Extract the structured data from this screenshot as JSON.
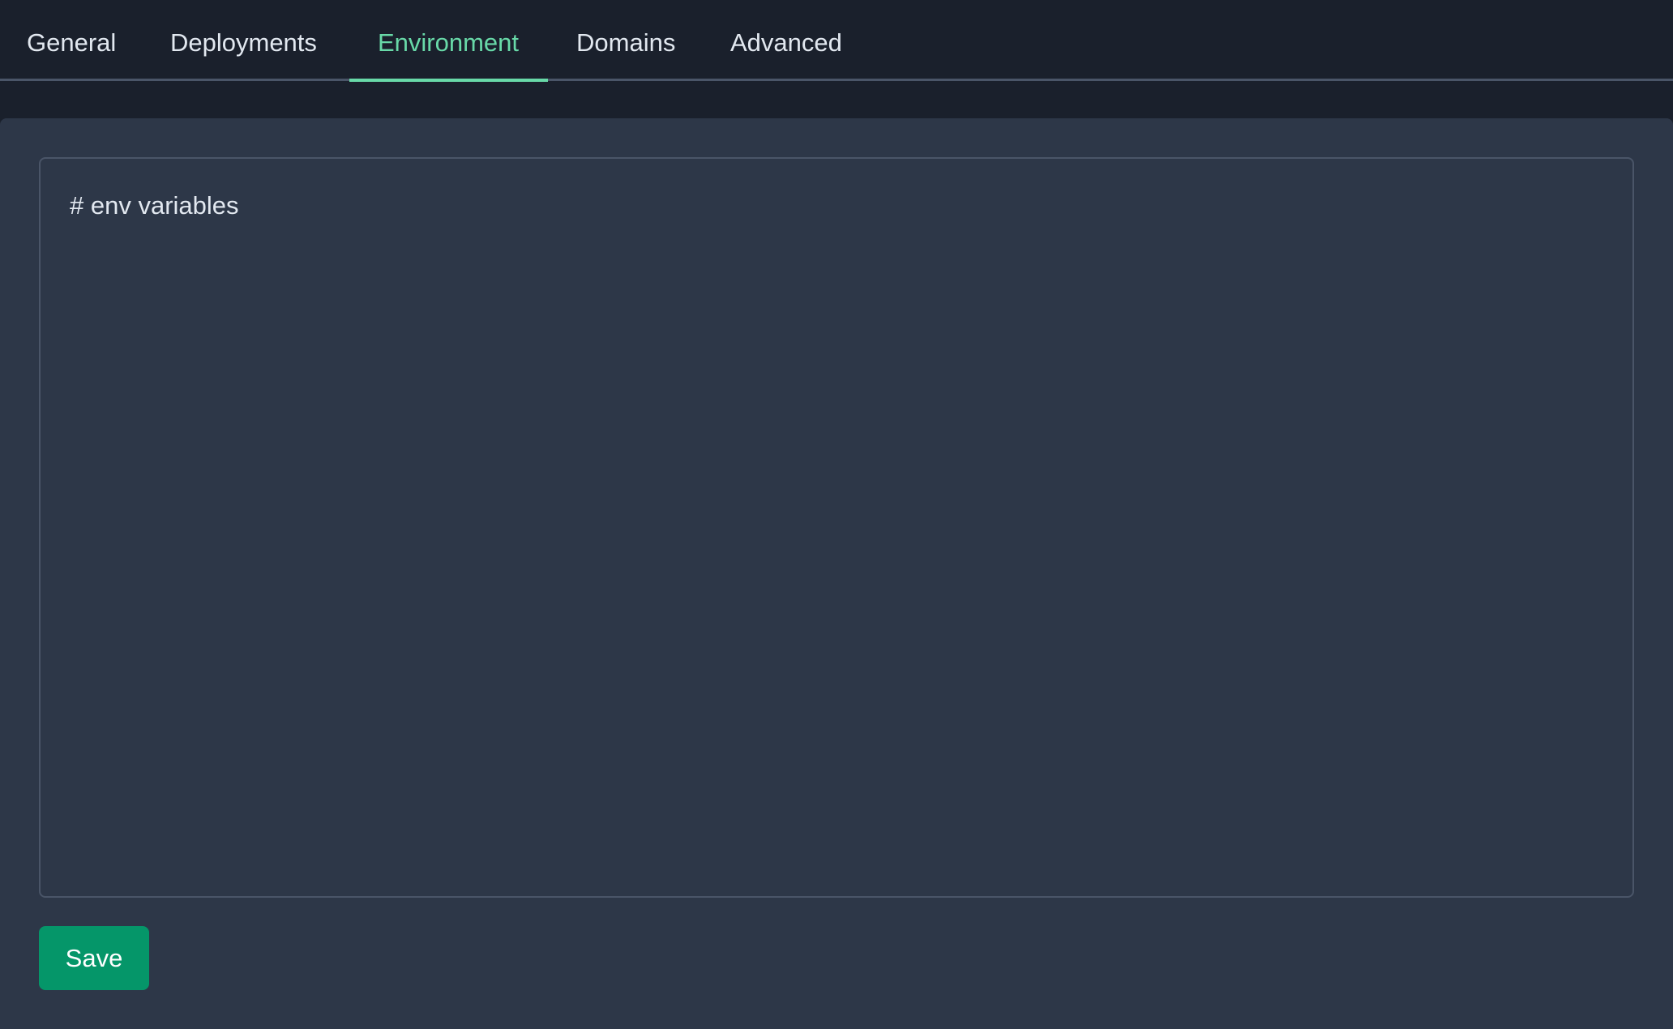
{
  "tabs": [
    {
      "label": "General",
      "active": false
    },
    {
      "label": "Deployments",
      "active": false
    },
    {
      "label": "Environment",
      "active": true
    },
    {
      "label": "Domains",
      "active": false
    },
    {
      "label": "Advanced",
      "active": false
    }
  ],
  "editor": {
    "value": "# env variables",
    "placeholder": ""
  },
  "actions": {
    "save_label": "Save"
  },
  "colors": {
    "background": "#1a202c",
    "panel": "#2d3748",
    "accent": "#68d9a8",
    "button": "#059669",
    "border": "#4a5568",
    "text": "#e2e8f0"
  }
}
